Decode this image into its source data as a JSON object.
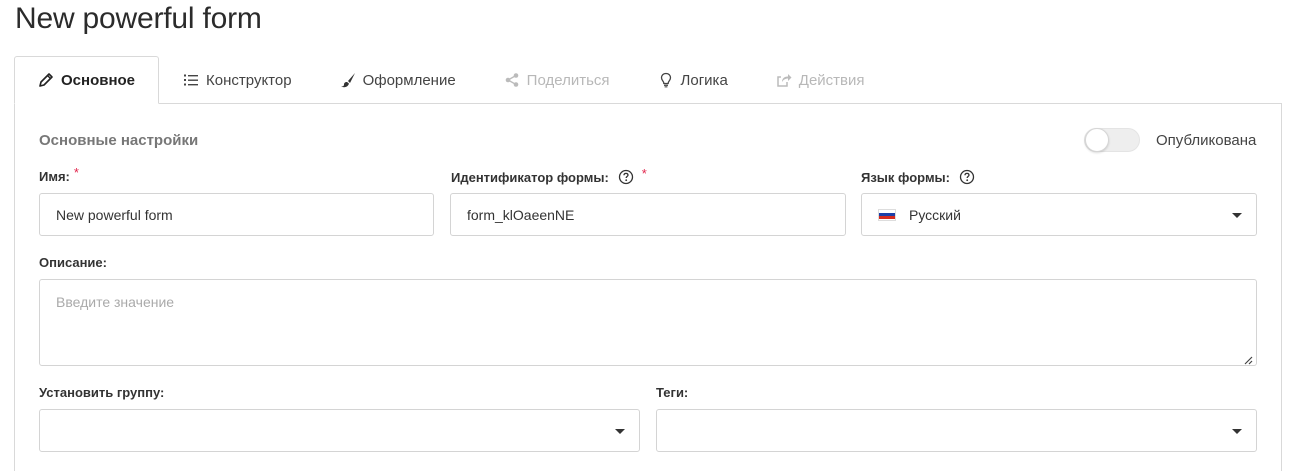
{
  "page": {
    "title": "New powerful form"
  },
  "tabs": [
    {
      "label": "Основное",
      "icon": "pencil-icon",
      "active": true,
      "disabled": false
    },
    {
      "label": "Конструктор",
      "icon": "list-icon",
      "active": false,
      "disabled": false
    },
    {
      "label": "Оформление",
      "icon": "brush-icon",
      "active": false,
      "disabled": false
    },
    {
      "label": "Поделиться",
      "icon": "share-icon",
      "active": false,
      "disabled": true
    },
    {
      "label": "Логика",
      "icon": "lightbulb-icon",
      "active": false,
      "disabled": false
    },
    {
      "label": "Действия",
      "icon": "external-link-icon",
      "active": false,
      "disabled": true
    }
  ],
  "settings": {
    "section_title": "Основные настройки",
    "published_label": "Опубликована",
    "published": false
  },
  "fields": {
    "name": {
      "label": "Имя:",
      "required_mark": "*",
      "value": "New powerful form"
    },
    "form_id": {
      "label": "Идентификатор формы:",
      "required_mark": "*",
      "value": "form_klOaeenNE"
    },
    "language": {
      "label": "Язык формы:",
      "value": "Русский",
      "flag_icon": "russia-flag-icon"
    },
    "description": {
      "label": "Описание:",
      "placeholder": "Введите значение"
    },
    "group": {
      "label": "Установить группу:",
      "value": ""
    },
    "tags": {
      "label": "Теги:",
      "value": ""
    }
  },
  "colors": {
    "required": "#e2264d",
    "border": "#d4d4d4",
    "disabled_text": "#b8b8b8"
  }
}
